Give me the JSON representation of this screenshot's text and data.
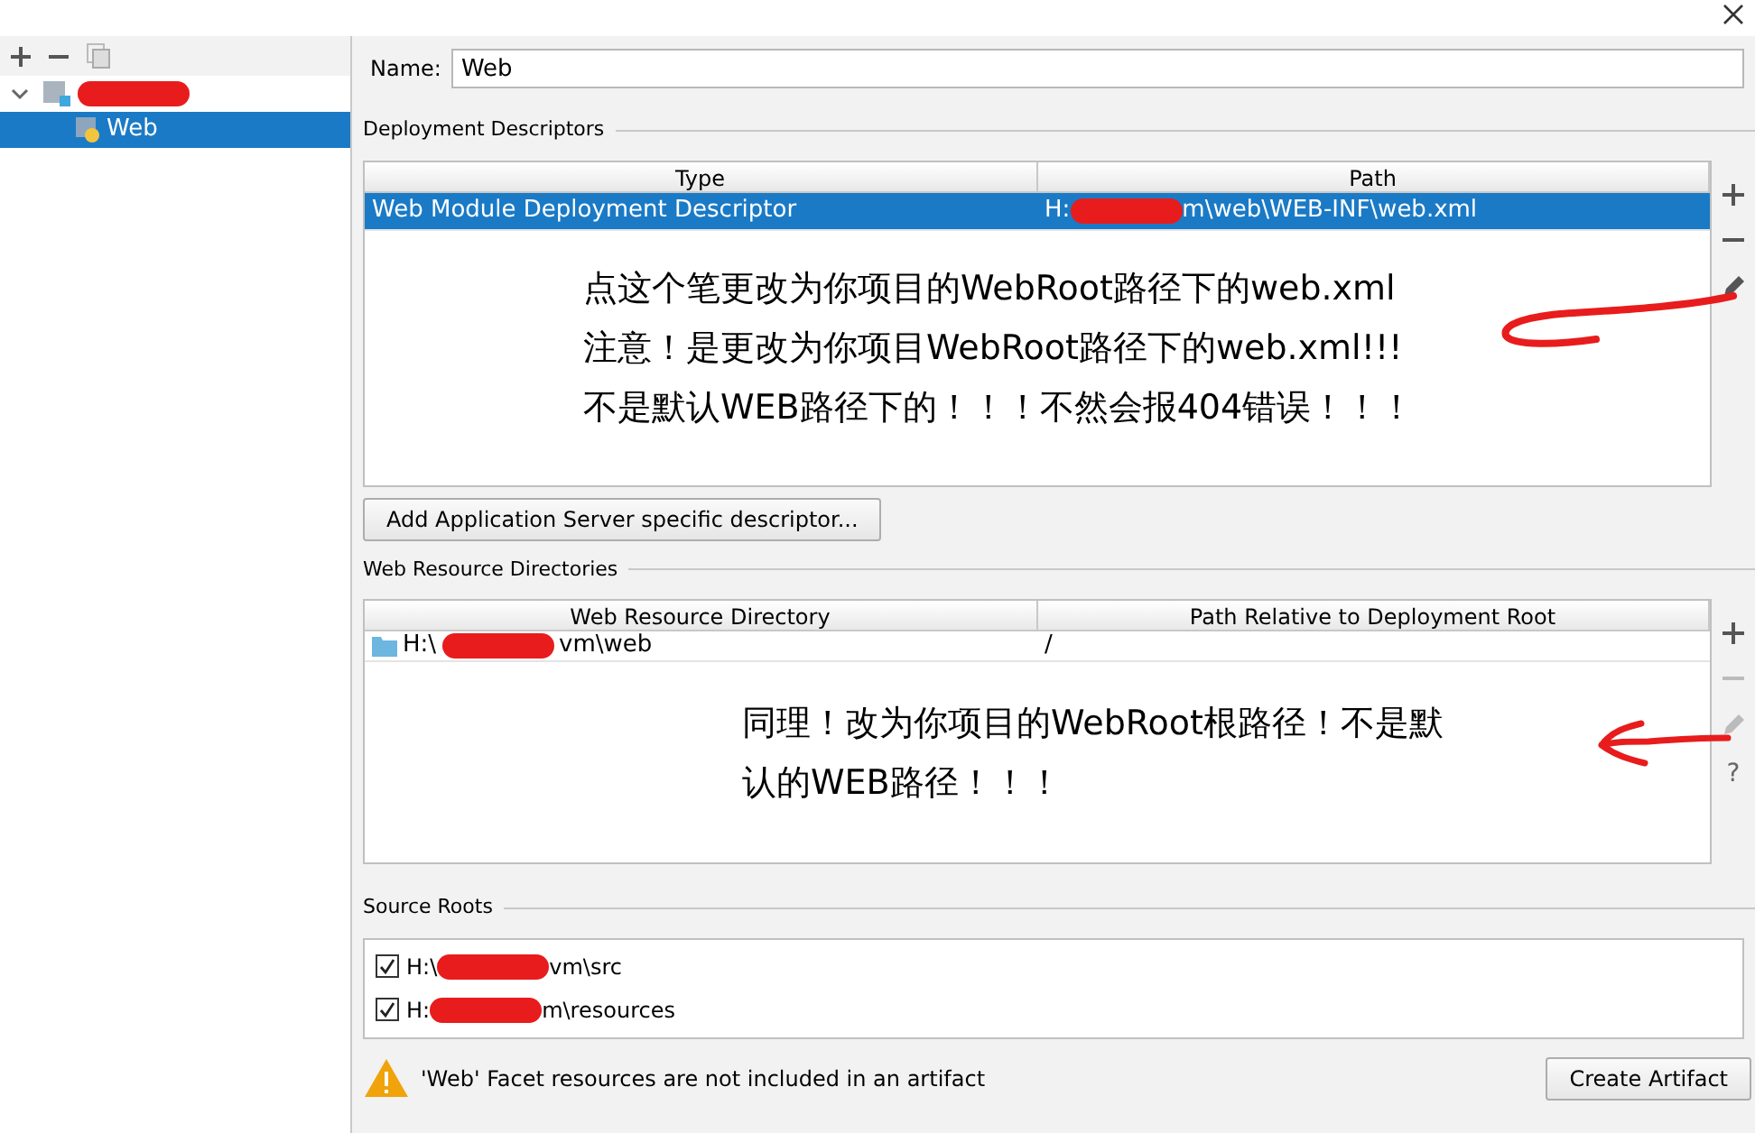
{
  "tree": [
    {
      "redacted": true,
      "expanded": true,
      "selected": false,
      "children": [
        {
          "label": "Web",
          "selected": true
        }
      ]
    }
  ],
  "name_field": {
    "label": "Name:",
    "value": "Web"
  },
  "deployment_descriptors": {
    "title": "Deployment Descriptors",
    "columns": [
      "Type",
      "Path"
    ],
    "rows": [
      {
        "type": "Web Module Deployment Descriptor",
        "path": {
          "prefix": "H:",
          "redacted": true,
          "suffix": "m\\web\\WEB-INF\\web.xml"
        },
        "selected": true
      }
    ],
    "note": [
      "点这个笔更改为你项目的WebRoot路径下的web.xml",
      "注意！是更改为你项目WebRoot路径下的web.xml!!!",
      "不是默认WEB路径下的！！！不然会报404错误！！！"
    ],
    "button": "Add Application Server specific descriptor..."
  },
  "web_resource_directories": {
    "title": "Web Resource Directories",
    "columns": [
      "Web Resource Directory",
      "Path Relative to Deployment Root"
    ],
    "rows": [
      {
        "directory": {
          "prefix": "H:\\",
          "redacted": true,
          "suffix": "vm\\web"
        },
        "relative": "/",
        "selected": false
      }
    ],
    "note": [
      "同理！改为你项目的WebRoot根路径！不是默",
      "认的WEB路径！！！"
    ],
    "help": "?"
  },
  "source_roots": {
    "title": "Source Roots",
    "items": [
      {
        "prefix": "H:\\",
        "redacted": true,
        "suffix": "vm\\src",
        "checked": true
      },
      {
        "prefix": "H:",
        "redacted": true,
        "suffix": "m\\resources",
        "checked": true
      }
    ]
  },
  "warning": {
    "text": "'Web' Facet resources are not included in an artifact",
    "button": "Create Artifact"
  }
}
